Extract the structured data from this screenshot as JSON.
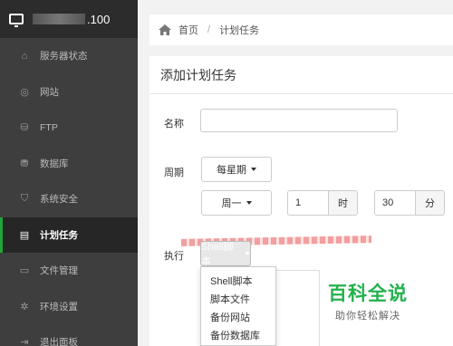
{
  "sidebar": {
    "server_suffix": ".100",
    "items": [
      {
        "label": "服务器状态",
        "icon": "home-icon",
        "glyph": "⌂"
      },
      {
        "label": "网站",
        "icon": "globe-icon",
        "glyph": "◎"
      },
      {
        "label": "FTP",
        "icon": "ftp-server-icon",
        "glyph": "⛁"
      },
      {
        "label": "数据库",
        "icon": "database-icon",
        "glyph": "⛃"
      },
      {
        "label": "系统安全",
        "icon": "shield-icon",
        "glyph": "⛉"
      },
      {
        "label": "计划任务",
        "icon": "schedule-icon",
        "glyph": "▤",
        "active": true
      },
      {
        "label": "文件管理",
        "icon": "folder-icon",
        "glyph": "▭"
      },
      {
        "label": "环境设置",
        "icon": "gear-icon",
        "glyph": "✲"
      },
      {
        "label": "退出面板",
        "icon": "logout-icon",
        "glyph": "⇥"
      }
    ]
  },
  "breadcrumb": {
    "home": "首页",
    "separator": "/",
    "current": "计划任务"
  },
  "panel": {
    "title": "添加计划任务"
  },
  "form": {
    "name_label": "名称",
    "name_value": "",
    "period_label": "周期",
    "period_type": "每星期",
    "weekday": "周一",
    "hour_value": "1",
    "hour_unit": "时",
    "minute_value": "30",
    "minute_unit": "分",
    "exec_label": "执行",
    "exec_selected": "Shell脚本"
  },
  "dropdown": {
    "options": [
      "Shell脚本",
      "脚本文件",
      "备份网站",
      "备份数据库"
    ]
  },
  "watermark": {
    "title": "百科全说",
    "subtitle": "助你轻松解决"
  },
  "colors": {
    "sidebar_bg": "#3e3e3e",
    "active_accent": "#20a53a",
    "watermark_green": "#22b14c"
  }
}
